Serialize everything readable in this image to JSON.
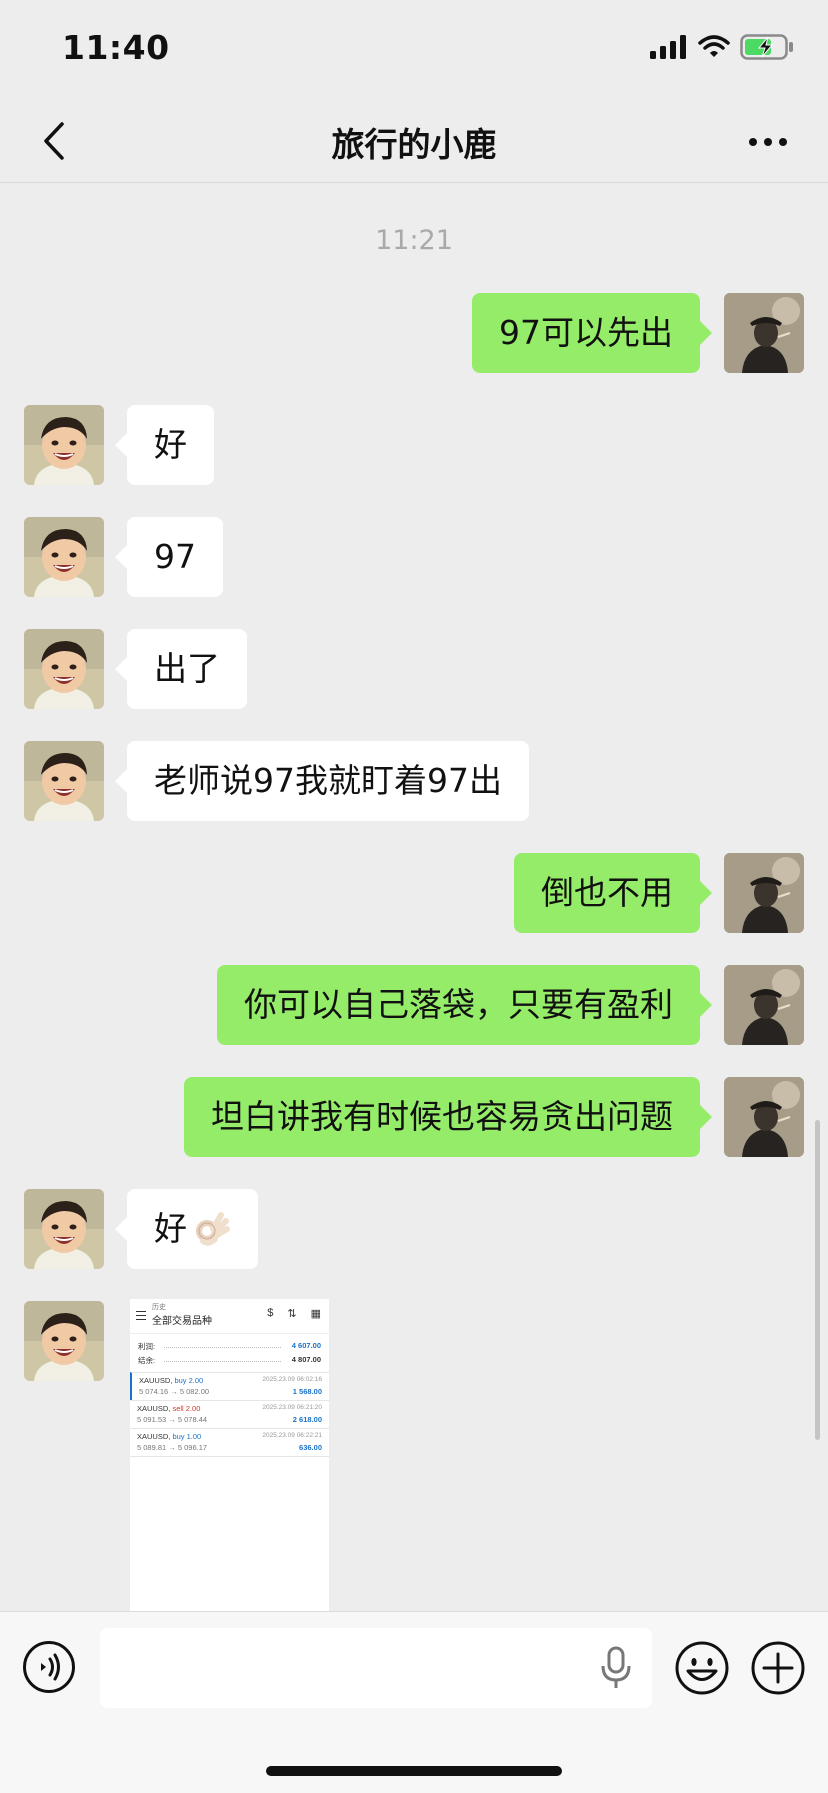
{
  "status_bar": {
    "time": "11:40"
  },
  "header": {
    "title": "旅行的小鹿"
  },
  "timestamp": "11:21",
  "messages": [
    {
      "side": "right",
      "text": "97可以先出"
    },
    {
      "side": "left",
      "text": "好"
    },
    {
      "side": "left",
      "text": "97"
    },
    {
      "side": "left",
      "text": "出了"
    },
    {
      "side": "left",
      "text": "老师说97我就盯着97出"
    },
    {
      "side": "right",
      "text": "倒也不用"
    },
    {
      "side": "right",
      "text": "你可以自己落袋，只要有盈利"
    },
    {
      "side": "right",
      "text": "坦白讲我有时候也容易贪出问题"
    },
    {
      "side": "left",
      "text": "好",
      "emoji": "ok-hand-emoji"
    },
    {
      "side": "left",
      "type": "image"
    }
  ],
  "screenshot": {
    "label_small": "历史",
    "label_title": "全部交易品种",
    "summary": [
      {
        "key": "利润:",
        "value": "4 607.00"
      },
      {
        "key": "结余:",
        "value": "4 807.00"
      }
    ],
    "trades": [
      {
        "symbol": "XAUUSD,",
        "action": "buy 2.00",
        "action_color": "#1a73c8",
        "prices": "5 074.16 → 5 082.00",
        "date": "2025.23.09 06:02:16",
        "profit": "1 568.00"
      },
      {
        "symbol": "XAUUSD,",
        "action": "sell 2.00",
        "action_color": "#d0392f",
        "prices": "5 091.53 → 5 078.44",
        "date": "2025.23.09 06:21:20",
        "profit": "2 618.00"
      },
      {
        "symbol": "XAUUSD,",
        "action": "buy 1.00",
        "action_color": "#1a73c8",
        "prices": "5 089.81 → 5 096.17",
        "date": "2025.23.09 06:22:21",
        "profit": "636.00"
      }
    ]
  },
  "colors": {
    "sent_bubble": "#95ec69",
    "received_bubble": "#ffffff",
    "background": "#ededed"
  }
}
